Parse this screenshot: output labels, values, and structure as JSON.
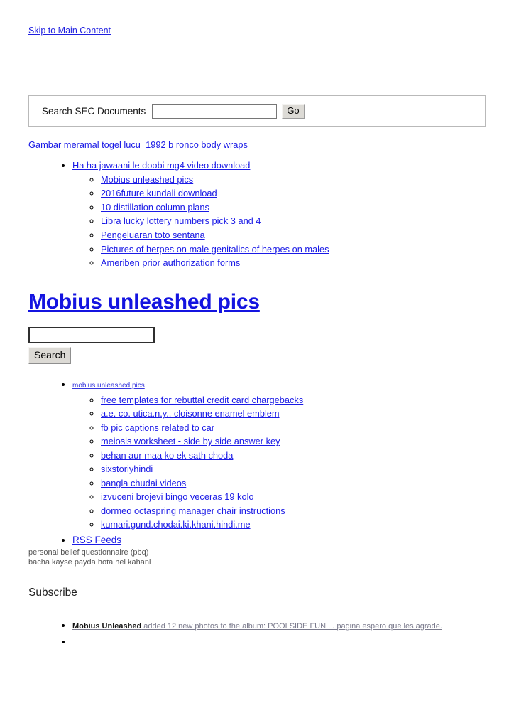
{
  "skip": {
    "label": "Skip to Main Content"
  },
  "sec_search": {
    "label": "Search SEC Documents",
    "value": "",
    "placeholder": "",
    "button_label": "Go"
  },
  "breadcrumb": {
    "links": [
      "Gambar meramal togel lucu",
      "1992 b ronco body wraps"
    ],
    "separator": "|"
  },
  "nav_list": {
    "parent": "Ha ha jawaani le doobi mg4 video download",
    "children": [
      "Mobius unleashed pics",
      "2016future kundali download",
      "10 distillation column plans",
      "Libra lucky lottery numbers pick 3 and 4",
      "Pengeluaran toto sentana",
      "Pictures of herpes on male genitalics of herpes on males",
      "Ameriben prior authorization forms"
    ]
  },
  "page_title": "Mobius unleashed pics",
  "site_search": {
    "value": "",
    "placeholder": "",
    "button_label": "Search"
  },
  "tag_list": {
    "parent": "mobius unleashed pics",
    "children": [
      "free templates for rebuttal credit card chargebacks",
      "a.e. co, utica,n.y., cloisonne enamel emblem",
      "fb pic captions related to car",
      "meiosis worksheet - side by side answer key",
      "behan aur maa ko ek sath choda",
      "sixstoriyhindi",
      "bangla chudai videos",
      "izvuceni brojevi bingo veceras 19 kolo",
      "dormeo octaspring manager chair instructions",
      "kumari.gund.chodai.ki.khani.hindi.me"
    ],
    "rss": "RSS Feeds"
  },
  "notes": [
    "personal belief questionnaire (pbq)",
    "bacha kayse payda hota hei kahani"
  ],
  "subscribe": {
    "heading": "Subscribe",
    "feed_items": [
      {
        "strong": "Mobius Unleashed",
        "rest": " added 12 new photos to the album: POOLSIDE FUN.. . pagina espero que les agrade."
      },
      {
        "strong": "",
        "rest": ""
      }
    ]
  },
  "colors": {
    "link": "#1a1ae6",
    "title_link": "#1414e0",
    "note_text": "#555555",
    "rule": "#d0d0d0",
    "button_face": "#dcdad5"
  }
}
